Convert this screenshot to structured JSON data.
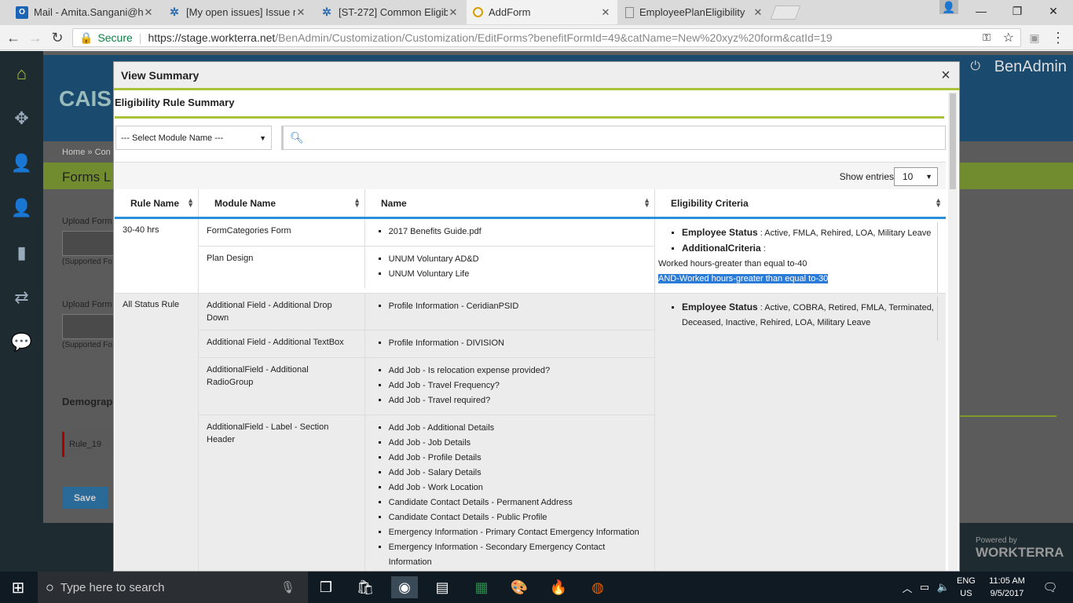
{
  "browser": {
    "tabs": [
      {
        "label": "Mail - Amita.Sangani@h",
        "icon": "outlook-icon",
        "color": "#1e64b4"
      },
      {
        "label": "[My open issues] Issue n",
        "icon": "jira-icon",
        "color": "#2d6bb3"
      },
      {
        "label": "[ST-272] Common Eligib",
        "icon": "jira-icon",
        "color": "#2d6bb3"
      },
      {
        "label": "AddForm",
        "icon": "workterra-icon",
        "color": "#d5a000"
      },
      {
        "label": "EmployeePlanEligibility",
        "icon": "page-icon",
        "color": "#888888"
      }
    ],
    "secure_label": "Secure",
    "url_host": "https://stage.workterra.net",
    "url_path": "/BenAdmin/Customization/Customization/EditForms?benefitFormId=49&catName=New%20xyz%20form&catId=19"
  },
  "background_app": {
    "brand": "BenAdmin",
    "company_partial": "CAIS",
    "breadcrumb_home": "Home",
    "breadcrumb_sep": "»",
    "breadcrumb_next": "Con",
    "forms_heading": "Forms L",
    "upload_label_1": "Upload Form",
    "supported_1": "(Supported Fo",
    "upload_label_2": "Upload Form",
    "supported_2": "(Supported Fo",
    "demographics": "Demograp",
    "rule_field": "Rule_19",
    "save_label": "Save",
    "powered_by": "Powered by",
    "powered_brand": "WORKTERRA"
  },
  "modal": {
    "title": "View Summary",
    "close": "×",
    "subtitle": "Eligibility Rule Summary",
    "select_placeholder": "--- Select Module Name ---",
    "show_entries_label": "Show entries",
    "entries_value": "10",
    "columns": [
      "Rule Name",
      "Module Name",
      "Name",
      "Eligibility Criteria"
    ],
    "rules": [
      {
        "rule": "30-40 hrs",
        "modules": [
          {
            "module": "FormCategories Form",
            "names": [
              "2017 Benefits Guide.pdf"
            ]
          },
          {
            "module": "Plan Design",
            "names": [
              "UNUM Voluntary AD&D",
              "UNUM Voluntary Life"
            ]
          }
        ],
        "criteria": {
          "status_label": "Employee Status",
          "status_value": ": Active, FMLA, Rehired, LOA, Military Leave",
          "additional_label": "AdditionalCriteria",
          "additional_sep": ":",
          "line1": "Worked hours-greater than equal to-40",
          "line2": "AND-Worked hours-greater than equal to-30"
        }
      },
      {
        "rule": "All Status Rule",
        "modules": [
          {
            "module": "Additional Field - Additional Drop Down",
            "names": [
              "Profile Information - CeridianPSID"
            ]
          },
          {
            "module": "Additional Field - Additional TextBox",
            "names": [
              "Profile Information - DIVISION"
            ]
          },
          {
            "module": "AdditionalField - Additional RadioGroup",
            "names": [
              "Add Job - Is relocation expense provided?",
              "Add Job - Travel Frequency?",
              "Add Job - Travel required?"
            ]
          },
          {
            "module": "AdditionalField - Label - Section Header",
            "names": [
              "Add Job - Additional Details",
              "Add Job - Job Details",
              "Add Job - Profile Details",
              "Add Job - Salary Details",
              "Add Job - Work Location",
              "Candidate Contact Details - Permanent Address",
              "Candidate Contact Details - Public Profile",
              "Emergency Information - Primary Contact Emergency Information",
              "Emergency Information - Secondary Emergency Contact Information"
            ]
          }
        ],
        "criteria": {
          "status_label": "Employee Status",
          "status_value": ": Active, COBRA, Retired, FMLA, Terminated, Deceased, Inactive, Rehired, LOA, Military Leave"
        }
      }
    ]
  },
  "taskbar": {
    "search_placeholder": "Type here to search",
    "lang1": "ENG",
    "lang2": "US",
    "time": "11:05 AM",
    "date": "9/5/2017"
  }
}
